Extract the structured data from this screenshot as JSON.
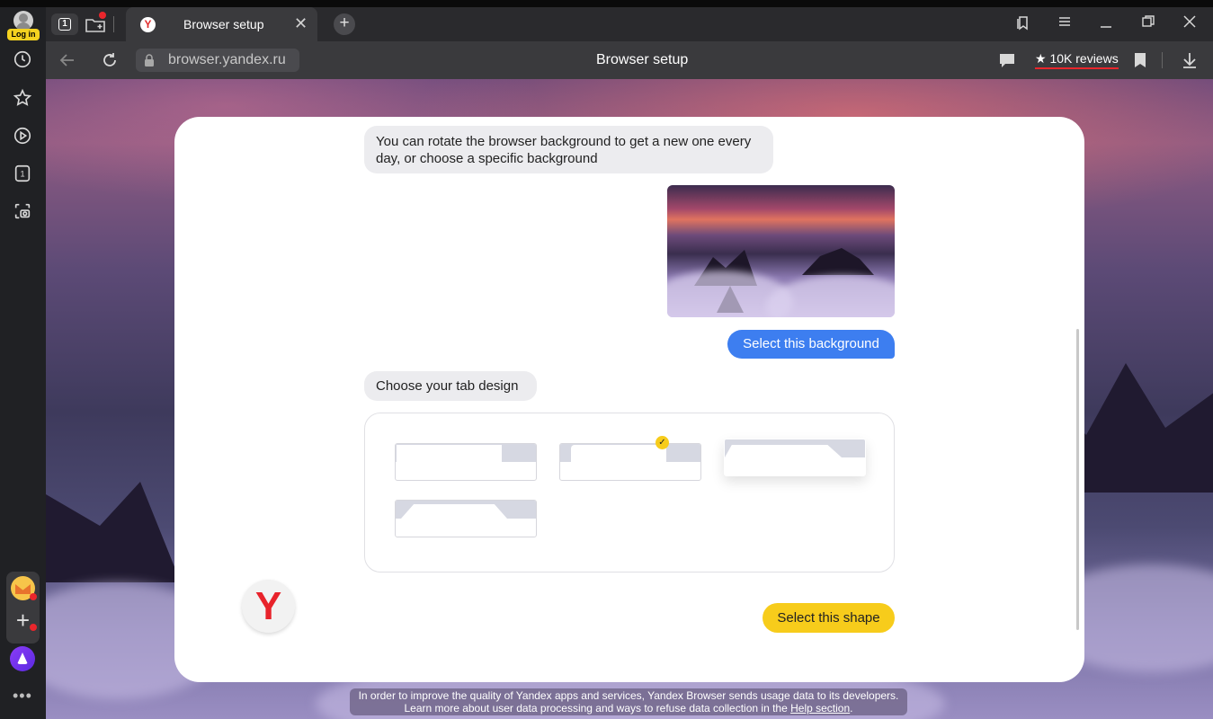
{
  "sidebar": {
    "login_label": "Log in",
    "icons": [
      "clock-icon",
      "star-icon",
      "play-icon",
      "tab-count-icon",
      "screenshot-icon"
    ],
    "tab_badge": "1"
  },
  "tabbar": {
    "tab_count": "1",
    "active_tab_title": "Browser setup",
    "close_glyph": "✕",
    "new_tab_glyph": "+"
  },
  "addressbar": {
    "url": "browser.yandex.ru",
    "page_title": "Browser setup",
    "reviews": "★ 10K reviews"
  },
  "dialog": {
    "msg_background": "You can rotate the browser background to get a new one every day, or choose a specific background",
    "select_background_button": "Select this background",
    "msg_tab_design": "Choose your tab design",
    "select_shape_button": "Select this shape",
    "selected_shape_index": 3
  },
  "footer": {
    "notice_line1": "In order to improve the quality of Yandex apps and services, Yandex Browser sends usage data to its developers.",
    "notice_line2": "Learn more about user data processing and ways to refuse data collection in the",
    "notice_link": "Help section",
    "notice_end": "."
  },
  "colors": {
    "accent_blue": "#3d7ef0",
    "accent_yellow": "#f7cc1b",
    "brand_red": "#e8232b"
  }
}
